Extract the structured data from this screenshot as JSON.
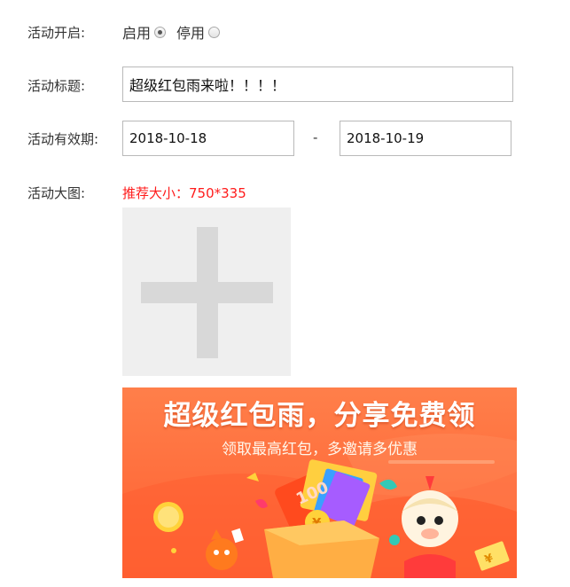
{
  "form": {
    "enable": {
      "label": "活动开启:",
      "options": [
        {
          "label": "启用",
          "checked": true
        },
        {
          "label": "停用",
          "checked": false
        }
      ]
    },
    "title": {
      "label": "活动标题:",
      "value": "超级红包雨来啦！！！！"
    },
    "period": {
      "label": "活动有效期:",
      "start": "2018-10-18",
      "separator": "-",
      "end": "2018-10-19"
    },
    "image": {
      "label": "活动大图:",
      "hint": "推荐大小：750*335",
      "upload_icon": "plus-icon"
    }
  },
  "banner": {
    "title": "超级红包雨，分享免费领",
    "subtitle": "领取最高红包，多邀请多优惠",
    "envelope_text": "100",
    "coin_symbol": "¥",
    "colors": {
      "background": "#ff6d3c",
      "envelope": "#ff4a1e",
      "coin": "#ffd23a"
    }
  }
}
